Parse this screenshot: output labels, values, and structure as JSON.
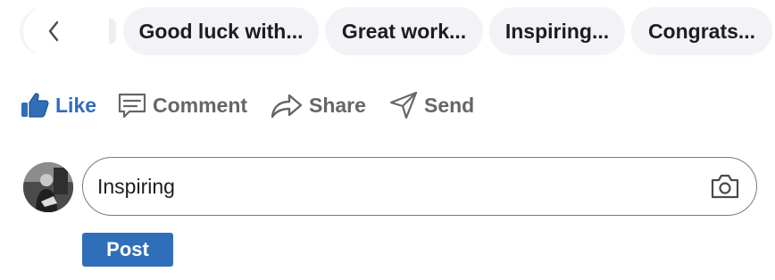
{
  "suggestions": {
    "items": [
      {
        "label": "Good luck with..."
      },
      {
        "label": "Great work..."
      },
      {
        "label": "Inspiring..."
      },
      {
        "label": "Congrats..."
      }
    ]
  },
  "actions": {
    "like": "Like",
    "comment": "Comment",
    "share": "Share",
    "send": "Send"
  },
  "composer": {
    "value": "Inspiring",
    "post_label": "Post"
  },
  "colors": {
    "accent": "#2f6fba",
    "chip_bg": "#f3f2f7",
    "muted_text": "#666666"
  },
  "icons": {
    "prev": "chevron-left-icon",
    "like": "thumbs-up-icon",
    "comment": "comment-icon",
    "share": "share-arrow-icon",
    "send": "send-icon",
    "camera": "camera-icon"
  }
}
